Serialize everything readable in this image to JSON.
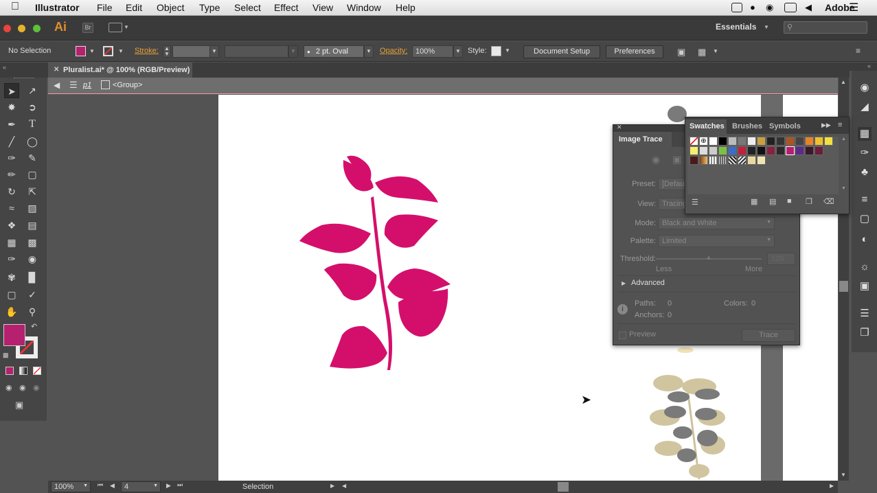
{
  "menubar": {
    "app": "Illustrator",
    "items": [
      "File",
      "Edit",
      "Object",
      "Type",
      "Select",
      "Effect",
      "View",
      "Window",
      "Help"
    ],
    "right_text": "Adobe"
  },
  "appbar": {
    "logo": "Ai",
    "bridge": "Br",
    "workspace": "Essentials"
  },
  "control": {
    "selection": "No Selection",
    "stroke_label": "Stroke:",
    "brush": "2 pt. Oval",
    "opacity_label": "Opacity:",
    "opacity_value": "100%",
    "style_label": "Style:",
    "document_setup": "Document Setup",
    "preferences": "Preferences",
    "fill_color": "#b5206f"
  },
  "document": {
    "tab_title": "Pluralist.ai* @ 100% (RGB/Preview)",
    "layer": "p1",
    "group": "<Group>"
  },
  "image_trace": {
    "title": "Image Trace",
    "preset_label": "Preset:",
    "preset_value": "[Defau",
    "view_label": "View:",
    "view_value": "Tracing",
    "mode_label": "Mode:",
    "mode_value": "Black and White",
    "palette_label": "Palette:",
    "palette_value": "Limited",
    "threshold_label": "Threshold:",
    "threshold_value": "128",
    "less": "Less",
    "more": "More",
    "advanced": "Advanced",
    "paths_label": "Paths:",
    "paths_value": "0",
    "colors_label": "Colors:",
    "colors_value": "0",
    "anchors_label": "Anchors:",
    "anchors_value": "0",
    "preview": "Preview",
    "trace": "Trace"
  },
  "swatches": {
    "tabs": [
      "Swatches",
      "Brushes",
      "Symbols"
    ]
  },
  "status": {
    "zoom": "100%",
    "artboard": "4",
    "tool": "Selection"
  },
  "colors": {
    "plant": "#d40f6b",
    "accent": "#e8a13a"
  }
}
